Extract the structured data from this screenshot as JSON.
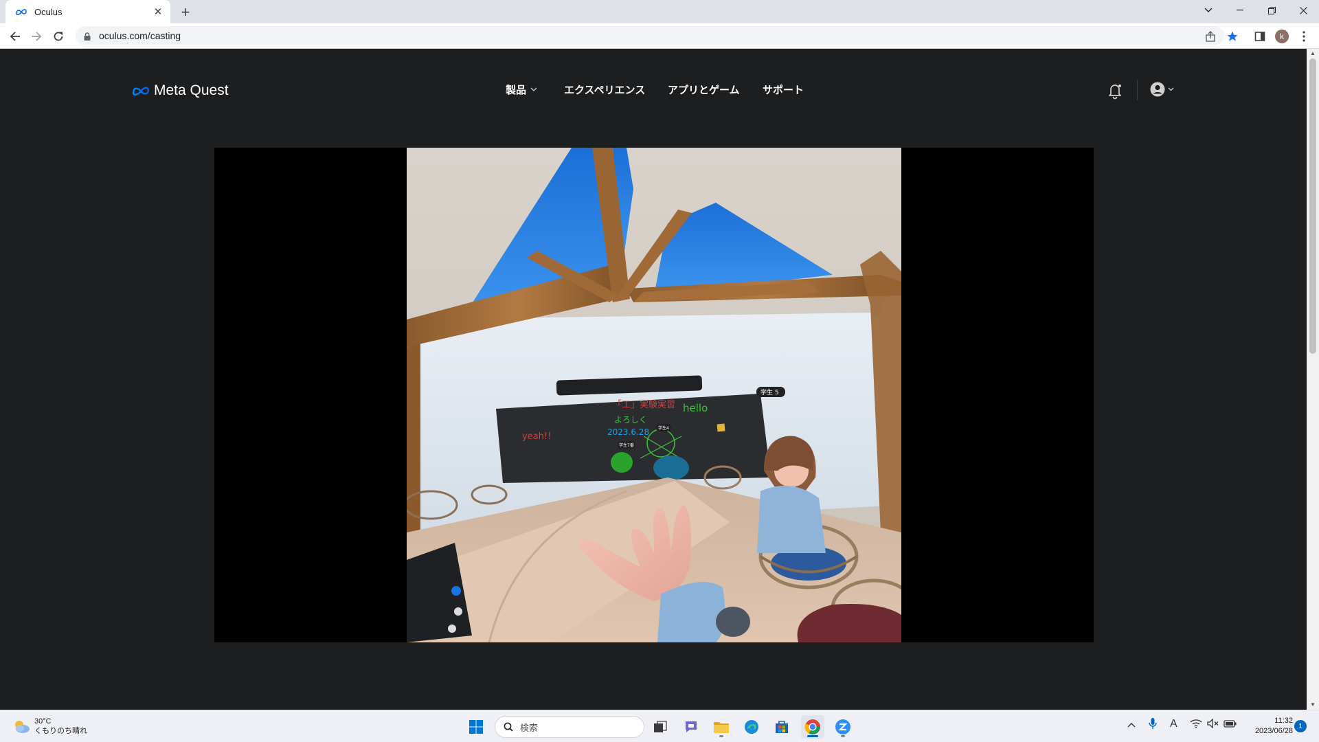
{
  "browser": {
    "tab_title": "Oculus",
    "url": "oculus.com/casting",
    "profile_initial": "k"
  },
  "site": {
    "logo_text": "Meta Quest",
    "nav": [
      {
        "label": "製品",
        "has_dropdown": true
      },
      {
        "label": "エクスペリエンス",
        "has_dropdown": false
      },
      {
        "label": "アプリとゲーム",
        "has_dropdown": false
      },
      {
        "label": "サポート",
        "has_dropdown": false
      }
    ]
  },
  "cast_view": {
    "board_header": "",
    "board_texts": [
      "「工」実験実習",
      "よろしく",
      "2023.6.28",
      "hello",
      "yeah!!"
    ],
    "avatar_tags": [
      "学生 5",
      "学生4",
      "学生7番"
    ],
    "scene": [
      "wooden-ceiling-beams",
      "skylight",
      "blackboard",
      "student-avatar",
      "round-table",
      "rattan-chairs",
      "pointing-hand",
      "wrist-menu"
    ]
  },
  "taskbar": {
    "weather_temp": "30°C",
    "weather_desc": "くもりのち晴れ",
    "search_placeholder": "検索",
    "time": "11:32",
    "date": "2023/06/28",
    "notification_count": "1",
    "ime_indicator": "A",
    "apps": [
      "start-icon",
      "task-view-icon",
      "teams-chat-icon",
      "file-explorer-icon",
      "edge-icon",
      "store-icon",
      "chrome-icon",
      "zoom-icon"
    ]
  },
  "colors": {
    "page_bg": "#1c1e20",
    "meta_blue": "#0866ff",
    "player_bg": "#000000"
  }
}
